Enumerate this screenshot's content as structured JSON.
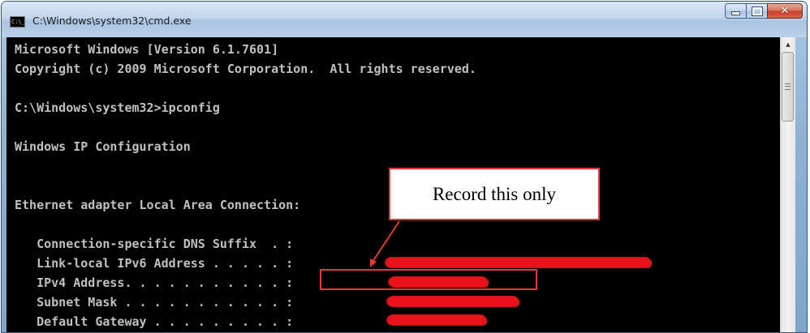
{
  "window": {
    "title": "C:\\Windows\\system32\\cmd.exe",
    "icon_text": "C:\\_"
  },
  "console": {
    "lines": [
      "Microsoft Windows [Version 6.1.7601]",
      "Copyright (c) 2009 Microsoft Corporation.  All rights reserved.",
      "",
      "C:\\Windows\\system32>ipconfig",
      "",
      "Windows IP Configuration",
      "",
      "",
      "Ethernet adapter Local Area Connection:",
      "",
      "   Connection-specific DNS Suffix  . :",
      "   Link-local IPv6 Address . . . . . :",
      "   IPv4 Address. . . . . . . . . . . :",
      "   Subnet Mask . . . . . . . . . . . :",
      "   Default Gateway . . . . . . . . . :"
    ]
  },
  "annotation": {
    "callout_text": "Record this only",
    "color": "#e23a2e"
  },
  "icons": {
    "minimize": "minimize-icon",
    "maximize": "maximize-icon",
    "close": "close-icon",
    "scroll_up": "chevron-up-icon"
  }
}
